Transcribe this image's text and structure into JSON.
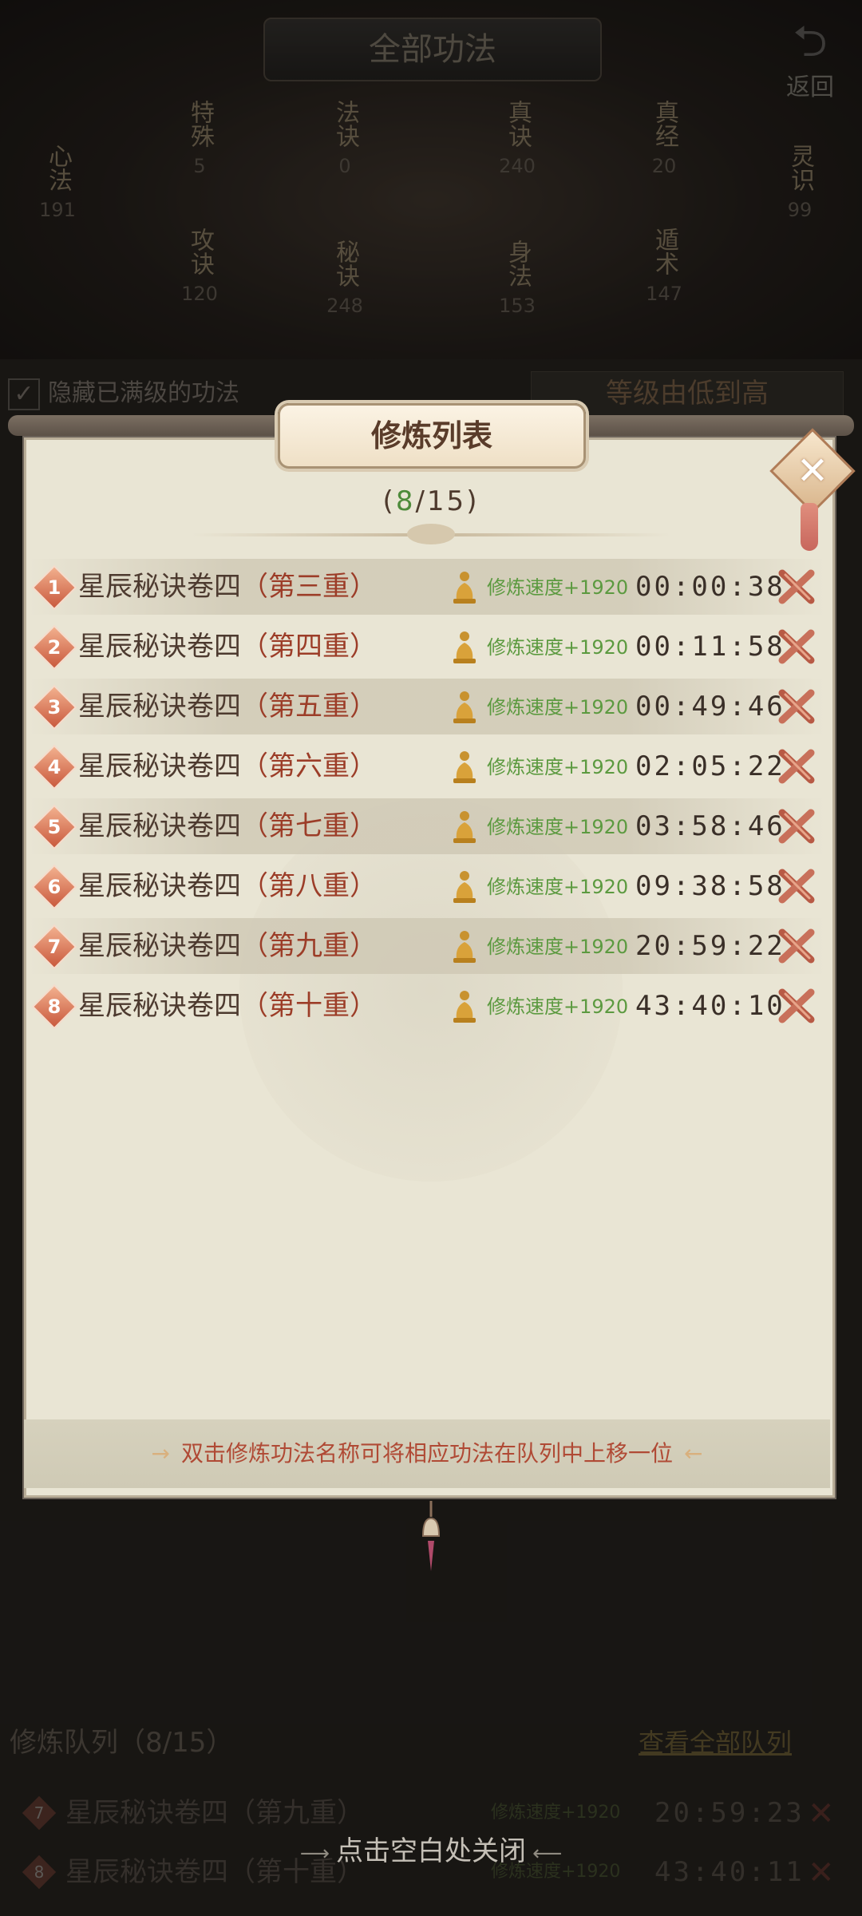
{
  "header": {
    "title": "全部功法",
    "back_label": "返回",
    "back_icon": "back-arrow-icon"
  },
  "categories": [
    {
      "label": "心法",
      "count": "191"
    },
    {
      "label": "特殊",
      "count": "5"
    },
    {
      "label": "攻诀",
      "count": "120"
    },
    {
      "label": "法诀",
      "count": "0"
    },
    {
      "label": "秘诀",
      "count": "248"
    },
    {
      "label": "真诀",
      "count": "240"
    },
    {
      "label": "身法",
      "count": "153"
    },
    {
      "label": "真经",
      "count": "20"
    },
    {
      "label": "遁术",
      "count": "147"
    },
    {
      "label": "灵识",
      "count": "99"
    }
  ],
  "filter": {
    "hide_maxed_label": "隐藏已满级的功法",
    "sort_label": "等级由低到高"
  },
  "dialog": {
    "title": "修炼列表",
    "counter_open": "(",
    "counter_current": "8",
    "counter_sep": "/",
    "counter_total": "15",
    "counter_close": ")",
    "items": [
      {
        "index": "1",
        "name": "星辰秘诀卷四",
        "layer": "（第三重）",
        "speed": "修炼速度+1920",
        "time": "00:00:38"
      },
      {
        "index": "2",
        "name": "星辰秘诀卷四",
        "layer": "（第四重）",
        "speed": "修炼速度+1920",
        "time": "00:11:58"
      },
      {
        "index": "3",
        "name": "星辰秘诀卷四",
        "layer": "（第五重）",
        "speed": "修炼速度+1920",
        "time": "00:49:46"
      },
      {
        "index": "4",
        "name": "星辰秘诀卷四",
        "layer": "（第六重）",
        "speed": "修炼速度+1920",
        "time": "02:05:22"
      },
      {
        "index": "5",
        "name": "星辰秘诀卷四",
        "layer": "（第七重）",
        "speed": "修炼速度+1920",
        "time": "03:58:46"
      },
      {
        "index": "6",
        "name": "星辰秘诀卷四",
        "layer": "（第八重）",
        "speed": "修炼速度+1920",
        "time": "09:38:58"
      },
      {
        "index": "7",
        "name": "星辰秘诀卷四",
        "layer": "（第九重）",
        "speed": "修炼速度+1920",
        "time": "20:59:22"
      },
      {
        "index": "8",
        "name": "星辰秘诀卷四",
        "layer": "（第十重）",
        "speed": "修炼速度+1920",
        "time": "43:40:10"
      }
    ],
    "hint": "双击修炼功法名称可将相应功法在队列中上移一位",
    "colors": {
      "accent_red": "#9c3d28",
      "speed_green": "#5c9a40",
      "counter_green": "#4d8b3a"
    }
  },
  "queue": {
    "title": "修炼队列（8/15）",
    "view_all_label": "查看全部队列",
    "items": [
      {
        "index": "7",
        "name": "星辰秘诀卷四（第九重）",
        "speed": "修炼速度+1920",
        "time": "20:59:23"
      },
      {
        "index": "8",
        "name": "星辰秘诀卷四（第十重）",
        "speed": "修炼速度+1920",
        "time": "43:40:11"
      }
    ]
  },
  "close_hint": "点击空白处关闭"
}
